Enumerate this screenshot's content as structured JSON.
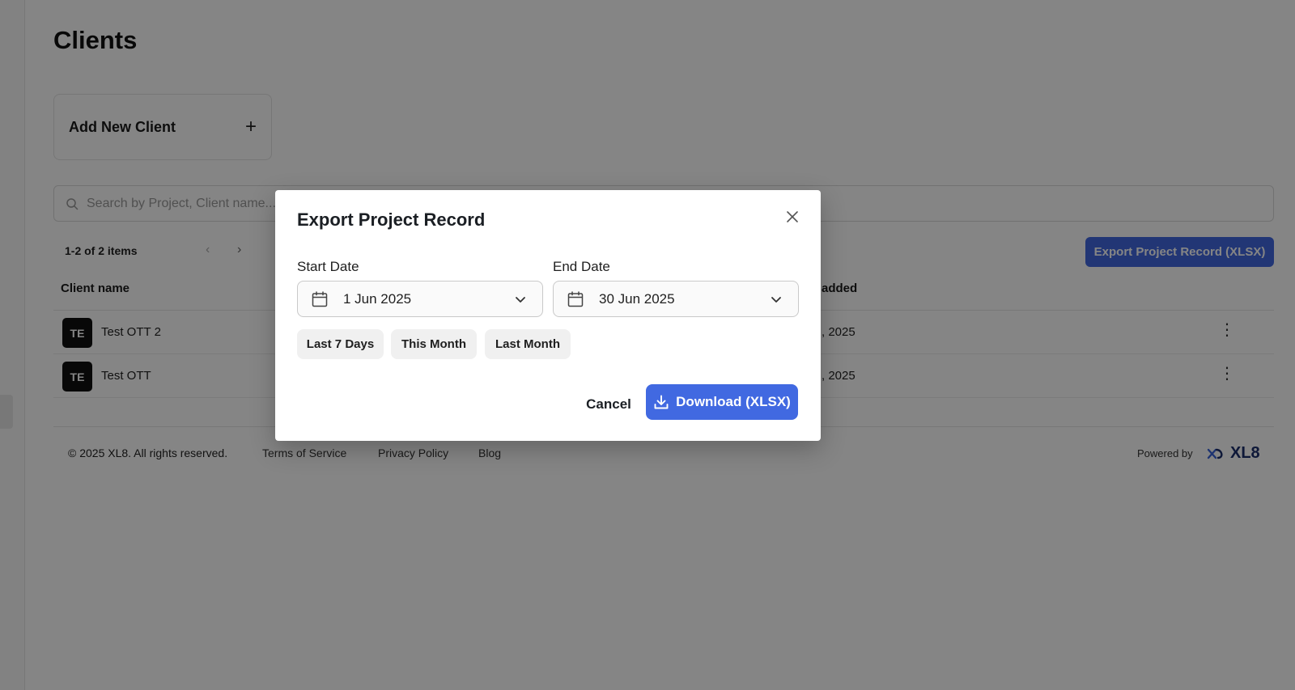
{
  "page": {
    "title": "Clients",
    "add_client_label": "Add New Client",
    "search_placeholder": "Search by Project, Client name...",
    "pagination": "1-2 of 2 items",
    "export_button": "Export Project Record (XLSX)",
    "columns": {
      "name": "Client name",
      "date_added": "added"
    },
    "rows": [
      {
        "avatar": "TE",
        "name": "Test OTT 2",
        "date": ", 2025"
      },
      {
        "avatar": "TE",
        "name": "Test OTT",
        "date": ", 2025"
      }
    ]
  },
  "footer": {
    "copyright": "© 2025 XL8. All rights reserved.",
    "terms": "Terms of Service",
    "privacy": "Privacy Policy",
    "blog": "Blog",
    "powered_by": "Powered by",
    "brand": "XL8"
  },
  "modal": {
    "title": "Export Project Record",
    "start_label": "Start Date",
    "start_value": "1 Jun 2025",
    "end_label": "End Date",
    "end_value": "30 Jun 2025",
    "presets": [
      "Last 7 Days",
      "This Month",
      "Last Month"
    ],
    "cancel_label": "Cancel",
    "download_label": "Download (XLSX)"
  },
  "colors": {
    "accent": "#4169e1",
    "brand_text": "#1c2f6b",
    "overlay": "rgba(0,0,0,0.48)"
  }
}
